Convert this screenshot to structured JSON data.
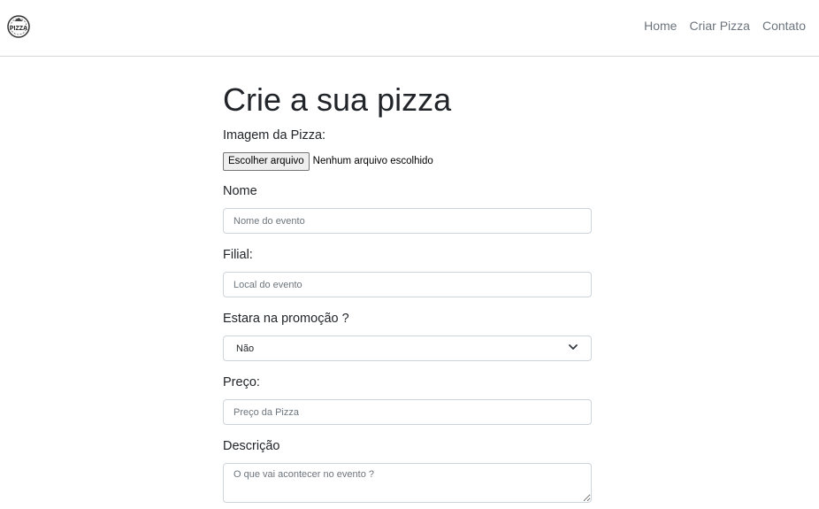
{
  "nav": {
    "logo_text": "PIZZA",
    "links": [
      "Home",
      "Criar Pizza",
      "Contato"
    ]
  },
  "form": {
    "title": "Crie a sua pizza",
    "image": {
      "label": "Imagem da Pizza:",
      "button_label": "Escolher arquivo",
      "status": "Nenhum arquivo escolhido"
    },
    "name": {
      "label": "Nome",
      "placeholder": "Nome do evento"
    },
    "branch": {
      "label": "Filial:",
      "placeholder": "Local do evento"
    },
    "promotion": {
      "label": "Estara na promoção ?",
      "selected": "Não"
    },
    "price": {
      "label": "Preço:",
      "placeholder": "Preço da Pizza"
    },
    "description": {
      "label": "Descrição",
      "placeholder": "O que vai acontecer no evento ?"
    }
  },
  "colors": {
    "nav_link": "#6c757d",
    "border": "#ced4da",
    "text": "#212529"
  }
}
